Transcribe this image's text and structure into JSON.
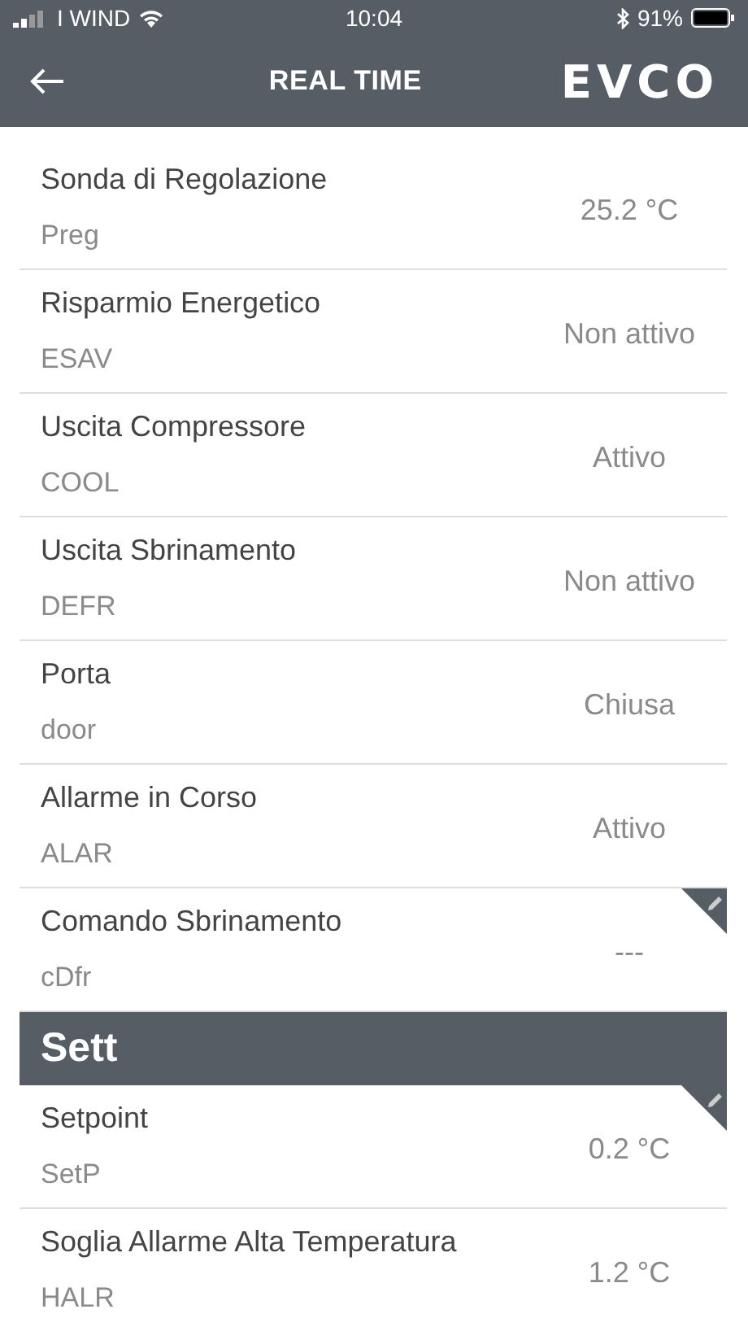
{
  "status_bar": {
    "carrier": "I WIND",
    "time": "10:04",
    "battery": "91%"
  },
  "nav": {
    "title": "REAL TIME",
    "logo": "EVCO"
  },
  "sections": [
    {
      "rows": [
        {
          "label": "Sonda di Regolazione",
          "code": "Preg",
          "value": "25.2 °C",
          "editable": false
        },
        {
          "label": "Risparmio Energetico",
          "code": "ESAV",
          "value": "Non attivo",
          "editable": false
        },
        {
          "label": "Uscita Compressore",
          "code": "COOL",
          "value": "Attivo",
          "editable": false
        },
        {
          "label": "Uscita Sbrinamento",
          "code": "DEFR",
          "value": "Non attivo",
          "editable": false
        },
        {
          "label": "Porta",
          "code": "door",
          "value": "Chiusa",
          "editable": false
        },
        {
          "label": "Allarme in Corso",
          "code": "ALAR",
          "value": "Attivo",
          "editable": false
        },
        {
          "label": "Comando Sbrinamento",
          "code": "cDfr",
          "value": "---",
          "editable": true
        }
      ]
    },
    {
      "title": "Sett",
      "rows": [
        {
          "label": "Setpoint",
          "code": "SetP",
          "value": "0.2 °C",
          "editable": true
        },
        {
          "label": "Soglia Allarme Alta Temperatura",
          "code": "HALR",
          "value": "1.2 °C",
          "editable": false
        }
      ]
    }
  ]
}
